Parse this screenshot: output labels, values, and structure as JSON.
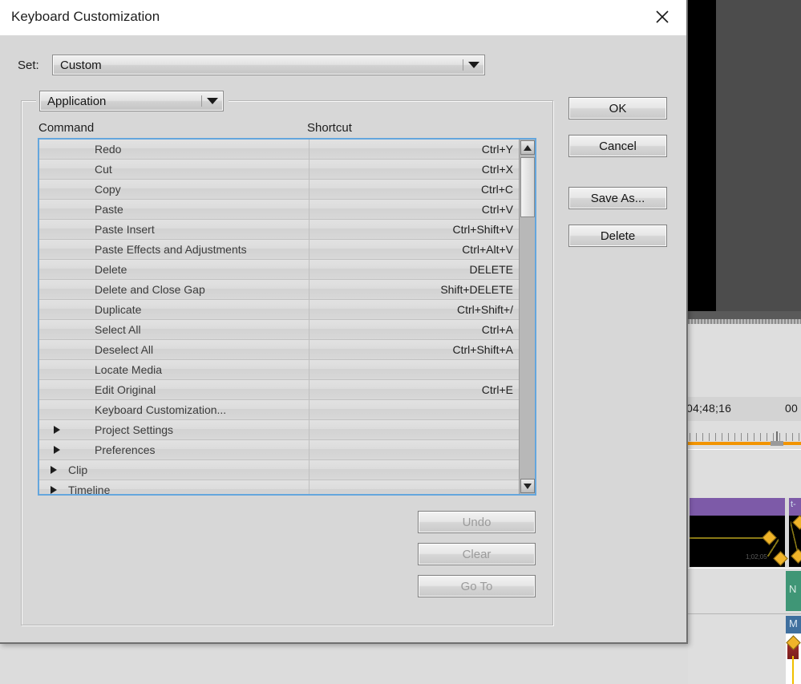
{
  "window": {
    "title": "Keyboard Customization",
    "close_icon": "close-icon"
  },
  "set_row": {
    "label": "Set:",
    "value": "Custom"
  },
  "category": {
    "value": "Application"
  },
  "columns": {
    "command": "Command",
    "shortcut": "Shortcut"
  },
  "rows": [
    {
      "command": "Redo",
      "shortcut": "Ctrl+Y",
      "indent": 2,
      "expander": false
    },
    {
      "command": "Cut",
      "shortcut": "Ctrl+X",
      "indent": 2,
      "expander": false
    },
    {
      "command": "Copy",
      "shortcut": "Ctrl+C",
      "indent": 2,
      "expander": false
    },
    {
      "command": "Paste",
      "shortcut": "Ctrl+V",
      "indent": 2,
      "expander": false
    },
    {
      "command": "Paste Insert",
      "shortcut": "Ctrl+Shift+V",
      "indent": 2,
      "expander": false
    },
    {
      "command": "Paste Effects and Adjustments",
      "shortcut": "Ctrl+Alt+V",
      "indent": 2,
      "expander": false
    },
    {
      "command": "Delete",
      "shortcut": "DELETE",
      "indent": 2,
      "expander": false
    },
    {
      "command": "Delete and Close Gap",
      "shortcut": "Shift+DELETE",
      "indent": 2,
      "expander": false
    },
    {
      "command": "Duplicate",
      "shortcut": "Ctrl+Shift+/",
      "indent": 2,
      "expander": false
    },
    {
      "command": "Select All",
      "shortcut": "Ctrl+A",
      "indent": 2,
      "expander": false
    },
    {
      "command": "Deselect All",
      "shortcut": "Ctrl+Shift+A",
      "indent": 2,
      "expander": false
    },
    {
      "command": "Locate Media",
      "shortcut": "",
      "indent": 2,
      "expander": false
    },
    {
      "command": "Edit Original",
      "shortcut": "Ctrl+E",
      "indent": 2,
      "expander": false
    },
    {
      "command": "Keyboard Customization...",
      "shortcut": "",
      "indent": 2,
      "expander": false
    },
    {
      "command": "Project Settings",
      "shortcut": "",
      "indent": 2,
      "expander": true
    },
    {
      "command": "Preferences",
      "shortcut": "",
      "indent": 2,
      "expander": true
    },
    {
      "command": "Clip",
      "shortcut": "",
      "indent": 1,
      "expander": true
    },
    {
      "command": "Timeline",
      "shortcut": "",
      "indent": 1,
      "expander": true
    }
  ],
  "scrollbar": {
    "up_icon": "chevron-up-icon",
    "down_icon": "chevron-down-icon"
  },
  "buttons": {
    "ok": "OK",
    "cancel": "Cancel",
    "save_as": "Save As...",
    "delete": "Delete",
    "undo": "Undo",
    "clear": "Clear",
    "go_to": "Go To"
  },
  "background": {
    "timecode_left": "04;48;16",
    "timecode_right": "00",
    "clip_label_1": "t-",
    "clip_label_green": "N",
    "clip_label_blue": "M",
    "clip_inner_time": "1;02;05",
    "accent_orange": "#f29400",
    "clip_purple": "#7d5aa8",
    "clip_green": "#3f9676",
    "clip_blue": "#3f6f9e",
    "keyframe_yellow": "#f0b429"
  }
}
